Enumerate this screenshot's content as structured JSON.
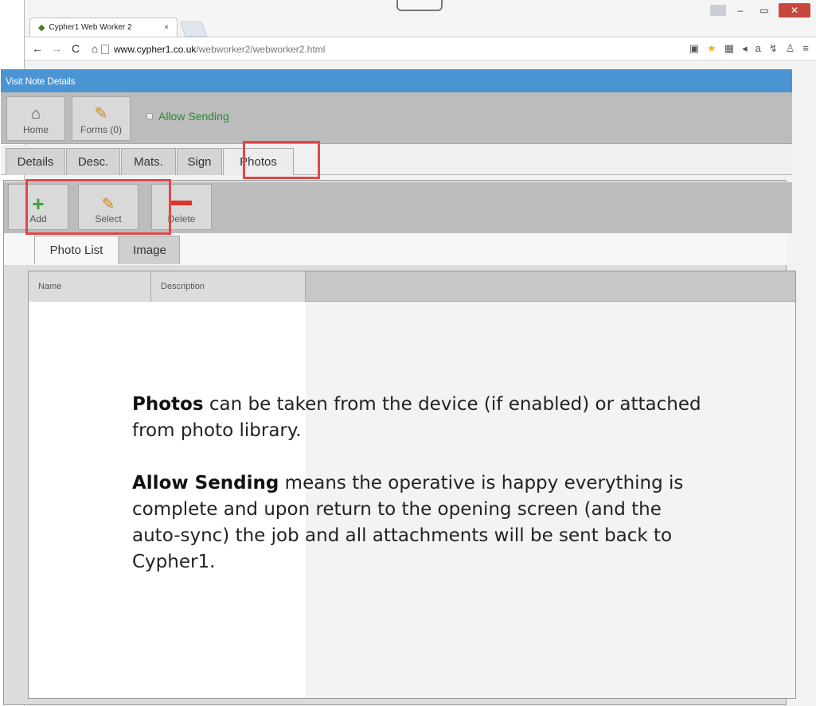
{
  "browser": {
    "tab_title": "Cypher1 Web Worker 2",
    "tab_close": "×",
    "url_host": "www.cypher1.co.uk",
    "url_path": "/webworker2/webworker2.html",
    "win_minimize": "–",
    "win_maximize": "▭",
    "win_close": "✕"
  },
  "app": {
    "header_title": "Visit Note Details",
    "toolbar": {
      "home_label": "Home",
      "forms_label": "Forms (0)",
      "allow_sending_label": "Allow Sending",
      "allow_sending_checked": false
    },
    "tabs": [
      {
        "label": "Details",
        "active": false
      },
      {
        "label": "Desc.",
        "active": false
      },
      {
        "label": "Mats.",
        "active": false
      },
      {
        "label": "Sign",
        "active": false
      },
      {
        "label": "Photos",
        "active": true
      }
    ],
    "photos_toolbar": {
      "add_label": "Add",
      "select_label": "Select",
      "delete_label": "Delete"
    },
    "subtabs": [
      {
        "label": "Photo List",
        "active": true
      },
      {
        "label": "Image",
        "active": false
      }
    ],
    "list_columns": [
      "Name",
      "Description"
    ]
  },
  "annotation": {
    "p1_bold": "Photos",
    "p1_text": " can be taken from the device (if enabled) or attached from photo library.",
    "p2_bold": "Allow Sending",
    "p2_text": " means the operative is happy everything is complete and upon return to the opening screen (and the auto-sync) the job and all attachments will be sent back to Cypher1."
  },
  "colors": {
    "header_blue": "#4a94d4",
    "highlight_red": "#e04848",
    "allow_green": "#2a8a2a"
  }
}
